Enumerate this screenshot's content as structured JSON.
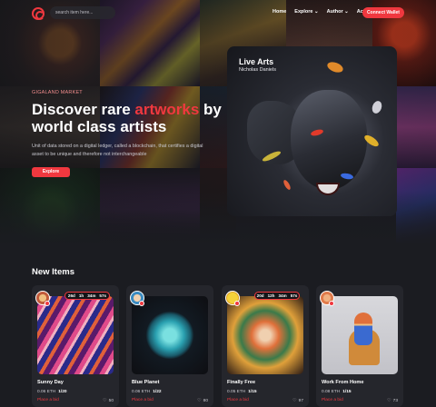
{
  "nav": {
    "search_placeholder": "search item here...",
    "menu": [
      "Home",
      "Explore",
      "Author",
      "Activity"
    ],
    "connect_label": "Connect Wallet"
  },
  "hero": {
    "kicker": "GIGALAND MARKET",
    "title_pre": "Discover rare ",
    "title_accent": "artworks",
    "title_post": " by world class artists",
    "description": "Unit of data stored on a digital ledger, called a blockchain, that certifies a digital asset to be unique and therefore not interchangeable",
    "cta_label": "Explore"
  },
  "featured": {
    "title": "Live Arts",
    "artist": "Nicholas Daniels"
  },
  "new_items": {
    "title": "New Items",
    "items": [
      {
        "name": "Sunny Day",
        "price": "0.06 ETH",
        "edition": "1/20",
        "bid": "Place a bid",
        "likes": "50",
        "countdown": [
          "26d",
          "1h",
          "34m",
          "57s"
        ]
      },
      {
        "name": "Blue Planet",
        "price": "0.06 ETH",
        "edition": "1/22",
        "bid": "Place a bid",
        "likes": "80",
        "countdown": null
      },
      {
        "name": "Finally Free",
        "price": "0.05 ETH",
        "edition": "1/15",
        "bid": "Place a bid",
        "likes": "97",
        "countdown": [
          "20d",
          "12h",
          "34m",
          "57s"
        ]
      },
      {
        "name": "Work From Home",
        "price": "0.08 ETH",
        "edition": "1/15",
        "bid": "Place a bid",
        "likes": "73",
        "countdown": null
      }
    ]
  },
  "colors": {
    "accent": "#f0383f",
    "background": "#1b1c21",
    "card": "#25262c"
  }
}
